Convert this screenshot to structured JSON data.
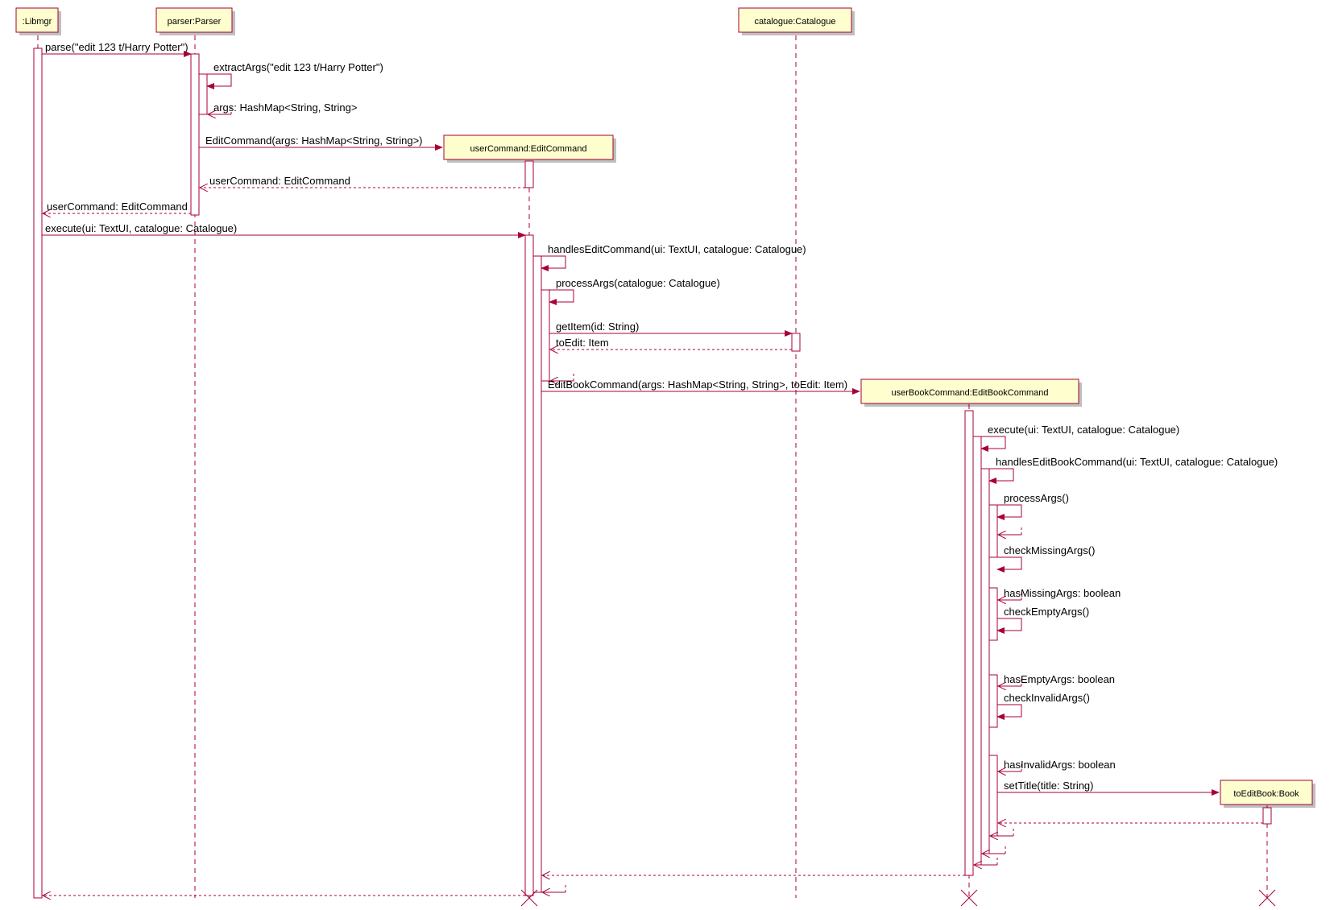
{
  "participants": {
    "libmgr": ":Libmgr",
    "parser": "parser:Parser",
    "catalogue": "catalogue:Catalogue",
    "usercmd": "userCommand:EditCommand",
    "bookcmd": "userBookCommand:EditBookCommand",
    "book": "toEditBook:Book"
  },
  "messages": {
    "m1": "parse(\"edit 123 t/Harry Potter\")",
    "m2": "extractArgs(\"edit 123 t/Harry Potter\")",
    "m3": "args: HashMap<String, String>",
    "m4": "EditCommand(args: HashMap<String, String>)",
    "m5": "userCommand: EditCommand",
    "m6": "userCommand: EditCommand",
    "m7": "execute(ui: TextUI, catalogue: Catalogue)",
    "m8": "handlesEditCommand(ui: TextUI, catalogue: Catalogue)",
    "m9": "processArgs(catalogue: Catalogue)",
    "m10": "getItem(id: String)",
    "m11": "toEdit: Item",
    "m12": "EditBookCommand(args: HashMap<String, String>, toEdit: Item)",
    "m13": "execute(ui: TextUI, catalogue: Catalogue)",
    "m14": "handlesEditBookCommand(ui: TextUI, catalogue: Catalogue)",
    "m15": "processArgs()",
    "m16": "checkMissingArgs()",
    "m17": "hasMissingArgs: boolean",
    "m18": "checkEmptyArgs()",
    "m19": "hasEmptyArgs: boolean",
    "m20": "checkInvalidArgs()",
    "m21": "hasInvalidArgs: boolean",
    "m22": "setTitle(title: String)"
  },
  "chart_data": {
    "type": "uml-sequence",
    "participants": [
      {
        "id": "libmgr",
        "label": ":Libmgr"
      },
      {
        "id": "parser",
        "label": "parser:Parser"
      },
      {
        "id": "catalogue",
        "label": "catalogue:Catalogue"
      },
      {
        "id": "usercmd",
        "label": "userCommand:EditCommand",
        "created_by": "parser"
      },
      {
        "id": "bookcmd",
        "label": "userBookCommand:EditBookCommand",
        "created_by": "usercmd"
      },
      {
        "id": "book",
        "label": "toEditBook:Book",
        "created_by": "bookcmd"
      }
    ],
    "interactions": [
      {
        "from": "libmgr",
        "to": "parser",
        "label": "parse(\"edit 123 t/Harry Potter\")",
        "type": "call"
      },
      {
        "from": "parser",
        "to": "parser",
        "label": "extractArgs(\"edit 123 t/Harry Potter\")",
        "type": "self"
      },
      {
        "from": "parser",
        "to": "parser",
        "label": "args: HashMap<String, String>",
        "type": "return"
      },
      {
        "from": "parser",
        "to": "usercmd",
        "label": "EditCommand(args: HashMap<String, String>)",
        "type": "create"
      },
      {
        "from": "usercmd",
        "to": "parser",
        "label": "userCommand: EditCommand",
        "type": "return"
      },
      {
        "from": "parser",
        "to": "libmgr",
        "label": "userCommand: EditCommand",
        "type": "return"
      },
      {
        "from": "libmgr",
        "to": "usercmd",
        "label": "execute(ui: TextUI, catalogue: Catalogue)",
        "type": "call"
      },
      {
        "from": "usercmd",
        "to": "usercmd",
        "label": "handlesEditCommand(ui: TextUI, catalogue: Catalogue)",
        "type": "self"
      },
      {
        "from": "usercmd",
        "to": "usercmd",
        "label": "processArgs(catalogue: Catalogue)",
        "type": "self"
      },
      {
        "from": "usercmd",
        "to": "catalogue",
        "label": "getItem(id: String)",
        "type": "call"
      },
      {
        "from": "catalogue",
        "to": "usercmd",
        "label": "toEdit: Item",
        "type": "return"
      },
      {
        "from": "usercmd",
        "to": "usercmd",
        "label": "",
        "type": "return"
      },
      {
        "from": "usercmd",
        "to": "bookcmd",
        "label": "EditBookCommand(args: HashMap<String, String>, toEdit: Item)",
        "type": "create"
      },
      {
        "from": "bookcmd",
        "to": "bookcmd",
        "label": "execute(ui: TextUI, catalogue: Catalogue)",
        "type": "self"
      },
      {
        "from": "bookcmd",
        "to": "bookcmd",
        "label": "handlesEditBookCommand(ui: TextUI, catalogue: Catalogue)",
        "type": "self"
      },
      {
        "from": "bookcmd",
        "to": "bookcmd",
        "label": "processArgs()",
        "type": "self"
      },
      {
        "from": "bookcmd",
        "to": "bookcmd",
        "label": "checkMissingArgs()",
        "type": "self"
      },
      {
        "from": "bookcmd",
        "to": "bookcmd",
        "label": "hasMissingArgs: boolean",
        "type": "return"
      },
      {
        "from": "bookcmd",
        "to": "bookcmd",
        "label": "checkEmptyArgs()",
        "type": "self"
      },
      {
        "from": "bookcmd",
        "to": "bookcmd",
        "label": "hasEmptyArgs: boolean",
        "type": "return"
      },
      {
        "from": "bookcmd",
        "to": "bookcmd",
        "label": "checkInvalidArgs()",
        "type": "self"
      },
      {
        "from": "bookcmd",
        "to": "bookcmd",
        "label": "hasInvalidArgs: boolean",
        "type": "return"
      },
      {
        "from": "bookcmd",
        "to": "book",
        "label": "setTitle(title: String)",
        "type": "create"
      },
      {
        "from": "book",
        "to": "bookcmd",
        "label": "",
        "type": "return"
      },
      {
        "from": "bookcmd",
        "to": "bookcmd",
        "label": "",
        "type": "return"
      },
      {
        "from": "bookcmd",
        "to": "bookcmd",
        "label": "",
        "type": "return"
      },
      {
        "from": "bookcmd",
        "to": "usercmd",
        "label": "",
        "type": "return"
      },
      {
        "from": "usercmd",
        "to": "usercmd",
        "label": "",
        "type": "return"
      },
      {
        "from": "usercmd",
        "to": "libmgr",
        "label": "",
        "type": "return"
      }
    ],
    "destroyed": [
      "usercmd",
      "bookcmd",
      "book"
    ]
  }
}
